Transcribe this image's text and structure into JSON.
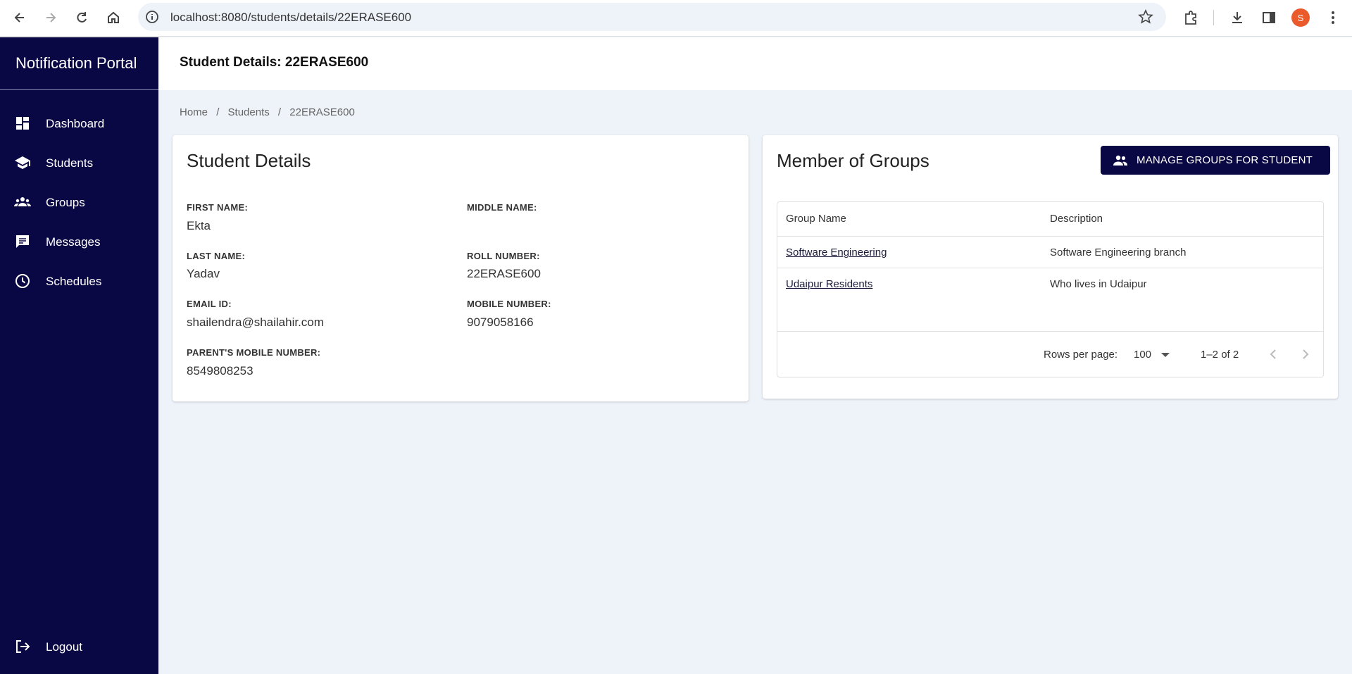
{
  "browser": {
    "url": "localhost:8080/students/details/22ERASE600",
    "profile_initial": "S"
  },
  "sidebar": {
    "brand": "Notification Portal",
    "items": [
      {
        "label": "Dashboard",
        "icon": "dashboard-icon"
      },
      {
        "label": "Students",
        "icon": "school-icon"
      },
      {
        "label": "Groups",
        "icon": "groups-icon"
      },
      {
        "label": "Messages",
        "icon": "message-icon"
      },
      {
        "label": "Schedules",
        "icon": "clock-icon"
      }
    ],
    "logout": "Logout"
  },
  "header": {
    "title": "Student Details: 22ERASE600"
  },
  "breadcrumb": {
    "home": "Home",
    "students": "Students",
    "current": "22ERASE600",
    "separator": "/"
  },
  "details": {
    "heading": "Student Details",
    "first_name_label": "FIRST NAME:",
    "first_name": "Ekta",
    "middle_name_label": "MIDDLE NAME:",
    "middle_name": "",
    "last_name_label": "LAST NAME:",
    "last_name": "Yadav",
    "roll_label": "ROLL NUMBER:",
    "roll": "22ERASE600",
    "email_label": "EMAIL ID:",
    "email": "shailendra@shailahir.com",
    "mobile_label": "MOBILE NUMBER:",
    "mobile": "9079058166",
    "parent_label": "PARENT'S MOBILE NUMBER:",
    "parent_mobile": "8549808253"
  },
  "groups": {
    "heading": "Member of Groups",
    "manage_button": "MANAGE GROUPS FOR STUDENT",
    "columns": [
      "Group Name",
      "Description"
    ],
    "rows": [
      {
        "name": "Software Engineering",
        "description": "Software Engineering branch"
      },
      {
        "name": "Udaipur Residents",
        "description": "Who lives in Udaipur"
      }
    ],
    "rows_per_page_label": "Rows per page:",
    "rows_per_page": "100",
    "range": "1–2 of 2"
  },
  "colors": {
    "sidebar_bg": "#0a0844",
    "page_bg": "#eef2f9",
    "accent": "#0a0844"
  }
}
